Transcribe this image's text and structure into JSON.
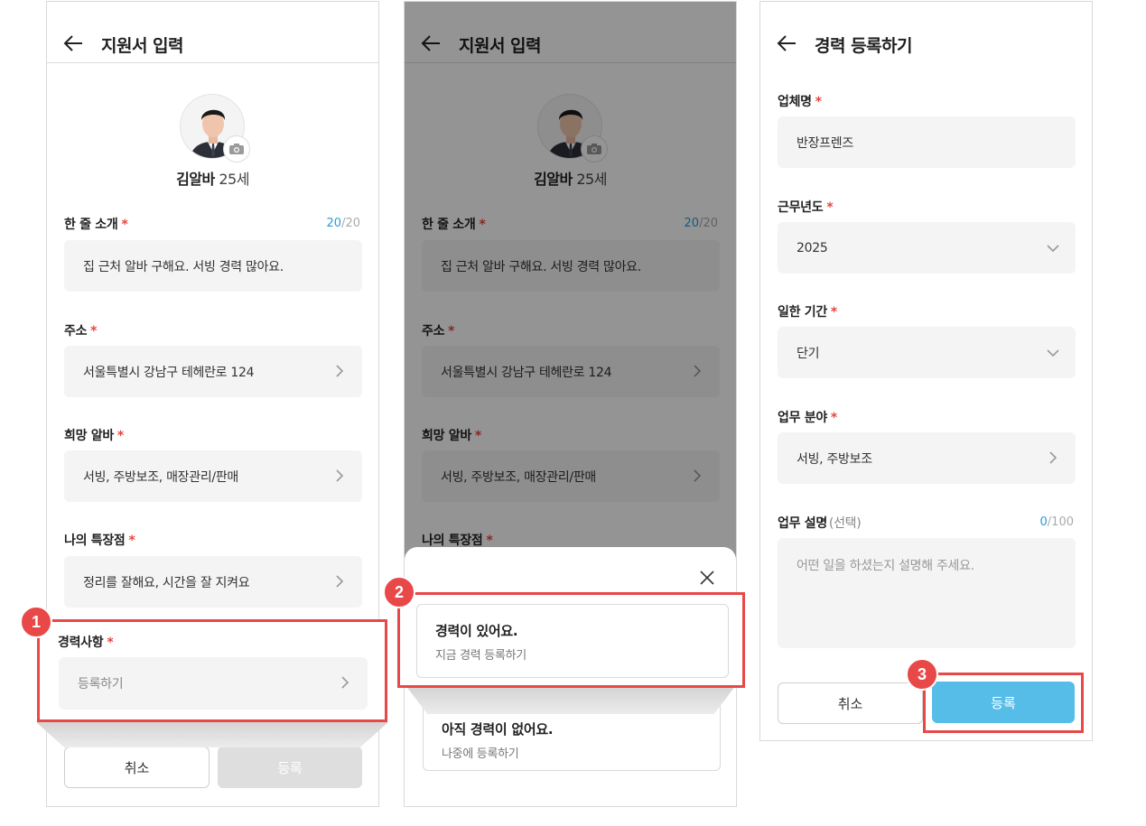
{
  "screen1": {
    "title": "지원서 입력",
    "profile": {
      "name": "김알바",
      "age": "25세"
    },
    "intro": {
      "label": "한 줄 소개",
      "required": "*",
      "count_current": "20",
      "count_max": "/20",
      "value": "집 근처 알바 구해요. 서빙 경력 많아요."
    },
    "address": {
      "label": "주소",
      "required": "*",
      "value": "서울특별시 강남구 테헤란로 124"
    },
    "desired_job": {
      "label": "희망 알바",
      "required": "*",
      "value": "서빙, 주방보조, 매장관리/판매"
    },
    "strength": {
      "label": "나의 특장점",
      "required": "*",
      "value": "정리를 잘해요, 시간을 잘 지켜요"
    },
    "career": {
      "label": "경력사항",
      "required": "*",
      "value": "등록하기"
    },
    "buttons": {
      "cancel": "취소",
      "submit": "등록"
    }
  },
  "screen2": {
    "title": "지원서 입력",
    "profile": {
      "name": "김알바",
      "age": "25세"
    },
    "intro": {
      "label": "한 줄 소개",
      "required": "*",
      "count_current": "20",
      "count_max": "/20",
      "value": "집 근처 알바 구해요. 서빙 경력 많아요."
    },
    "address": {
      "label": "주소",
      "required": "*",
      "value": "서울특별시 강남구 테헤란로 124"
    },
    "desired_job": {
      "label": "희망 알바",
      "required": "*",
      "value": "서빙, 주방보조, 매장관리/판매"
    },
    "strength": {
      "label": "나의 특장점",
      "required": "*"
    },
    "sheet": {
      "option1": {
        "title": "경력이 있어요.",
        "sub": "지금 경력 등록하기"
      },
      "option2": {
        "title": "아직 경력이 없어요.",
        "sub": "나중에 등록하기"
      }
    }
  },
  "screen3": {
    "title": "경력 등록하기",
    "company": {
      "label": "업체명",
      "required": "*",
      "value": "반장프렌즈"
    },
    "year": {
      "label": "근무년도",
      "required": "*",
      "value": "2025"
    },
    "period": {
      "label": "일한 기간",
      "required": "*",
      "value": "단기"
    },
    "field": {
      "label": "업무 분야",
      "required": "*",
      "value": "서빙, 주방보조"
    },
    "description": {
      "label": "업무 설명",
      "optional": "(선택)",
      "count_current": "0",
      "count_max": "/100",
      "placeholder": "어떤 일을 하셨는지 설명해 주세요."
    },
    "buttons": {
      "cancel": "취소",
      "submit": "등록"
    }
  },
  "steps": {
    "step1": "1",
    "step2": "2",
    "step3": "3"
  },
  "colors": {
    "accent": "#56bde9",
    "highlight": "#e84848",
    "required": "#e8453c",
    "counter": "#2c9bd8"
  }
}
